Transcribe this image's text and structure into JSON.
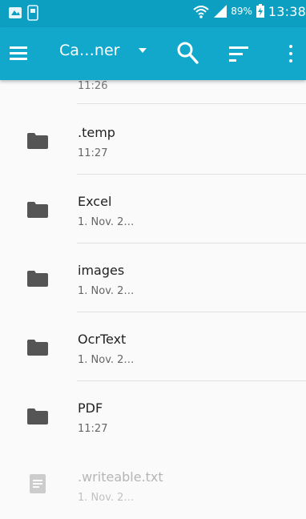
{
  "status_bar": {
    "battery_percent": "89%",
    "time": "13:38",
    "icons": [
      "notification-icon",
      "notification-icon-2",
      "wifi-icon",
      "signal-icon",
      "battery-charging-icon"
    ]
  },
  "app_bar": {
    "title": "Ca…ner",
    "icons": [
      "menu-icon",
      "dropdown-arrow-icon",
      "search-icon",
      "sort-icon",
      "more-vert-icon"
    ]
  },
  "files": {
    "partial_top": {
      "subtitle": "11:26"
    },
    "items": [
      {
        "name": ".temp",
        "subtitle": "11:27",
        "icon": "folder-icon"
      },
      {
        "name": "Excel",
        "subtitle": "1. Nov. 2…",
        "icon": "folder-icon"
      },
      {
        "name": "images",
        "subtitle": "1. Nov. 2…",
        "icon": "folder-icon"
      },
      {
        "name": "OcrText",
        "subtitle": "1. Nov. 2…",
        "icon": "folder-icon"
      },
      {
        "name": "PDF",
        "subtitle": "11:27",
        "icon": "folder-icon"
      },
      {
        "name": ".writeable.txt",
        "subtitle": "1. Nov. 2…",
        "icon": "file-icon"
      }
    ]
  },
  "colors": {
    "status_bar": "#0d9fc2",
    "app_bar": "#11a8cc",
    "folder_icon": "#555555",
    "file_icon_faded": "#cccccc"
  }
}
